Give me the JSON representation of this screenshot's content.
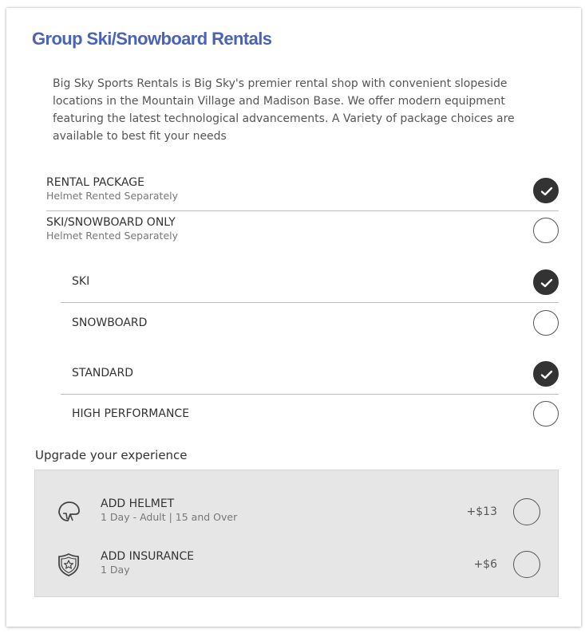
{
  "title": "Group Ski/Snowboard Rentals",
  "description": "Big Sky Sports Rentals is Big Sky's premier rental shop with convenient slopeside locations in the Mountain Village and Madison Base. We offer modern equipment featuring the latest technological advancements. A Variety of package choices are available to best fit your needs",
  "packages": [
    {
      "label": "RENTAL PACKAGE",
      "sublabel": "Helmet Rented Separately",
      "selected": true
    },
    {
      "label": "SKI/SNOWBOARD ONLY",
      "sublabel": "Helmet Rented Separately",
      "selected": false
    }
  ],
  "equipment": [
    {
      "label": "SKI",
      "selected": true
    },
    {
      "label": "SNOWBOARD",
      "selected": false
    }
  ],
  "performance": [
    {
      "label": "STANDARD",
      "selected": true
    },
    {
      "label": "HIGH PERFORMANCE",
      "selected": false
    }
  ],
  "upgrade": {
    "heading": "Upgrade your experience",
    "items": [
      {
        "label": "ADD HELMET",
        "sublabel": "1 Day - Adult | 15 and Over",
        "price": "+$13",
        "icon": "helmet-icon",
        "selected": false
      },
      {
        "label": "ADD INSURANCE",
        "sublabel": "1 Day",
        "price": "+$6",
        "icon": "shield-star-icon",
        "selected": false
      }
    ]
  }
}
